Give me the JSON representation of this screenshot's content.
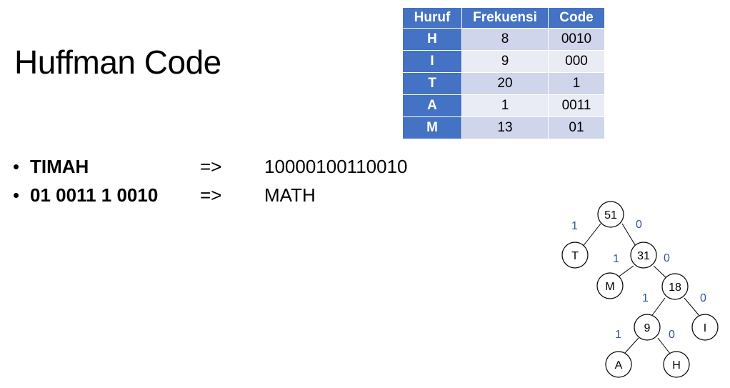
{
  "title": "Huffman Code",
  "table": {
    "headers": [
      "Huruf",
      "Frekuensi",
      "Code"
    ],
    "rows": [
      {
        "huruf": "H",
        "frekuensi": "8",
        "code": "0010"
      },
      {
        "huruf": "I",
        "frekuensi": "9",
        "code": "000"
      },
      {
        "huruf": "T",
        "frekuensi": "20",
        "code": "1"
      },
      {
        "huruf": "A",
        "frekuensi": "1",
        "code": "0011"
      },
      {
        "huruf": "M",
        "frekuensi": "13",
        "code": "01"
      }
    ]
  },
  "bullets": [
    {
      "bullet": "•",
      "code": "TIMAH",
      "arrow": "=>",
      "result": "10000100110010"
    },
    {
      "bullet": "•",
      "code": "01 0011 1 0010",
      "arrow": "=>",
      "result": "MATH"
    }
  ],
  "tree": {
    "nodes": {
      "n51": "51",
      "nT": "T",
      "n31": "31",
      "nM": "M",
      "n18": "18",
      "n9": "9",
      "nI": "I",
      "nA": "A",
      "nH": "H"
    },
    "edges": {
      "e51_T": "1",
      "e51_31": "0",
      "e31_M": "1",
      "e31_18": "0",
      "e18_9": "1",
      "e18_I": "0",
      "e9_A": "1",
      "e9_H": "0"
    }
  },
  "colors": {
    "header_blue": "#4472c4",
    "row_dark": "#cfd5ea",
    "row_light": "#e9ebf5",
    "edge_label": "#2f5597"
  }
}
